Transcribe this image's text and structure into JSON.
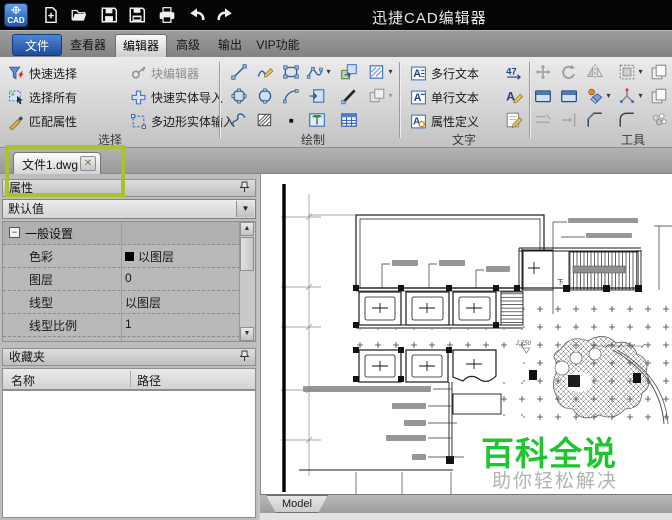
{
  "titlebar": {
    "title": "迅捷CAD编辑器",
    "logo_text": "CAD"
  },
  "menubar": {
    "items": [
      {
        "label": "文件"
      },
      {
        "label": "查看器"
      },
      {
        "label": "编辑器"
      },
      {
        "label": "高级"
      },
      {
        "label": "输出"
      },
      {
        "label": "VIP功能"
      }
    ]
  },
  "ribbon": {
    "select": {
      "label": "选择",
      "items": [
        "快速选择",
        "选择所有",
        "匹配属性",
        "块编辑器",
        "快速实体导入",
        "多边形实体输入"
      ]
    },
    "draw": {
      "label": "绘制"
    },
    "text": {
      "label": "文字",
      "items": [
        "多行文本",
        "单行文本",
        "属性定义"
      ]
    },
    "tools": {
      "label": "工具"
    }
  },
  "tabbar": {
    "tabs": [
      {
        "label": "文件1.dwg"
      }
    ]
  },
  "properties": {
    "title": "属性",
    "preset": "默认值",
    "section": "一般设置",
    "rows": [
      {
        "name": "色彩",
        "value": "以图层"
      },
      {
        "name": "图层",
        "value": "0"
      },
      {
        "name": "线型",
        "value": "以图层"
      },
      {
        "name": "线型比例",
        "value": "1"
      }
    ]
  },
  "favorites": {
    "title": "收藏夹",
    "columns": [
      "名称",
      "路径"
    ]
  },
  "canvas": {
    "model_tab": "Model",
    "elevation_label": "2.750",
    "stair_label": "下"
  },
  "watermark": {
    "title": "百科全说",
    "subtitle": "助你轻松解决"
  },
  "glyphs": {
    "close": "✕",
    "dropdown": "▾",
    "combo_arrow": "▼",
    "scroll_up": "▲",
    "scroll_down": "▼",
    "minus": "−"
  },
  "colors": {
    "watermark_green": "#1ec52e",
    "annotation_green": "#a9c32c",
    "accent_blue": "#2e62b4"
  }
}
